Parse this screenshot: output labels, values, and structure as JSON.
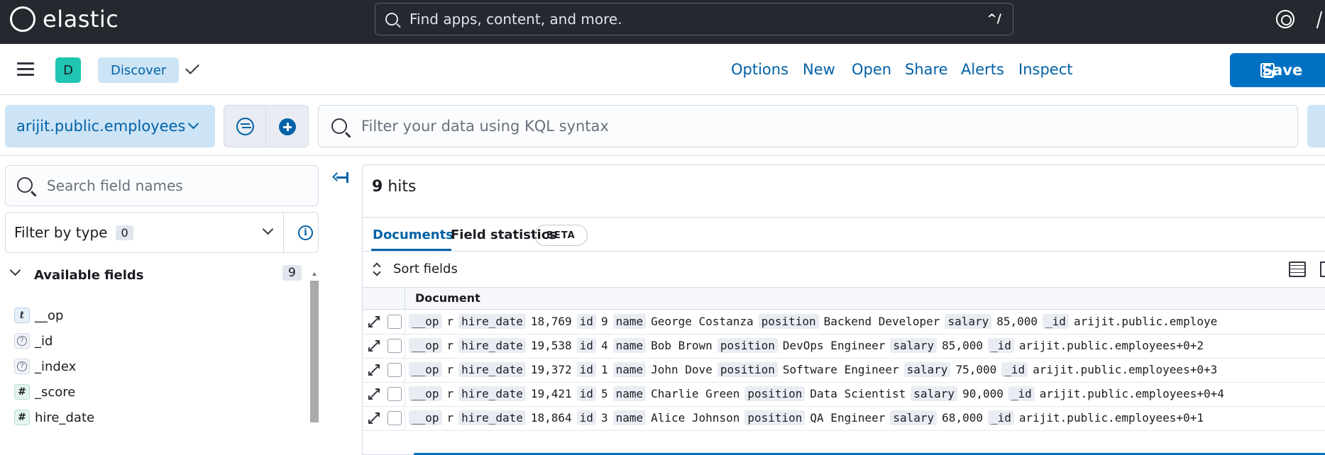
{
  "topbar": {
    "brand": "elastic",
    "search_placeholder": "Find apps, content, and more.",
    "search_shortcut": "^/"
  },
  "appbar": {
    "space_initial": "D",
    "breadcrumb": "Discover",
    "menu": [
      "Options",
      "New",
      "Open",
      "Share",
      "Alerts",
      "Inspect"
    ],
    "save_label": "Save"
  },
  "querybar": {
    "data_view": "arijit.public.employees",
    "kql_placeholder": "Filter your data using KQL syntax"
  },
  "sidebar": {
    "search_placeholder": "Search field names",
    "filter_by_type": "Filter by type",
    "filter_count": "0",
    "available_fields_label": "Available fields",
    "available_fields_count": "9",
    "fields": [
      {
        "type": "t",
        "name": "__op"
      },
      {
        "type": "?",
        "name": "_id"
      },
      {
        "type": "?",
        "name": "_index"
      },
      {
        "type": "#",
        "name": "_score"
      },
      {
        "type": "#",
        "name": "hire_date"
      }
    ]
  },
  "main": {
    "hits_count": "9",
    "hits_label": "hits",
    "tabs": [
      "Documents",
      "Field statistics"
    ],
    "beta_label": "BETA",
    "sort_label": "Sort fields",
    "column_header": "Document",
    "rows": [
      {
        "op": "r",
        "hire_date": "18,769",
        "id": "9",
        "name": "George Costanza",
        "position": "Backend Developer",
        "salary": "85,000",
        "_id": "arijit.public.employe"
      },
      {
        "op": "r",
        "hire_date": "19,538",
        "id": "4",
        "name": "Bob Brown",
        "position": "DevOps Engineer",
        "salary": "85,000",
        "_id": "arijit.public.employees+0+2"
      },
      {
        "op": "r",
        "hire_date": "19,372",
        "id": "1",
        "name": "John Dove",
        "position": "Software Engineer",
        "salary": "75,000",
        "_id": "arijit.public.employees+0+3"
      },
      {
        "op": "r",
        "hire_date": "19,421",
        "id": "5",
        "name": "Charlie Green",
        "position": "Data Scientist",
        "salary": "90,000",
        "_id": "arijit.public.employees+0+4"
      },
      {
        "op": "r",
        "hire_date": "18,864",
        "id": "3",
        "name": "Alice Johnson",
        "position": "QA Engineer",
        "salary": "68,000",
        "_id": "arijit.public.employees+0+1"
      }
    ],
    "keys": {
      "op": "__op",
      "hire_date": "hire_date",
      "id": "id",
      "name": "name",
      "position": "position",
      "salary": "salary",
      "_id": "_id"
    }
  }
}
